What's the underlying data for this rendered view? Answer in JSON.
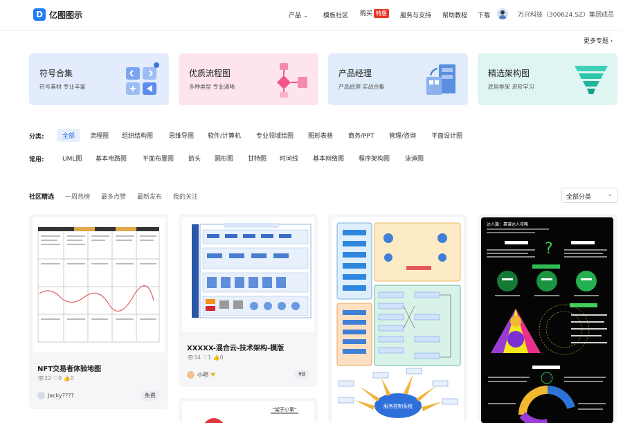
{
  "header": {
    "logo_mark": "D",
    "logo_text": "亿图图示",
    "nav": [
      {
        "label": "产品",
        "has_dropdown": true
      },
      {
        "label": "模板社区"
      },
      {
        "label": "购买",
        "badge": "特惠"
      },
      {
        "label": "服务与支持"
      },
      {
        "label": "帮助教程"
      },
      {
        "label": "下载"
      }
    ],
    "user_name": "万兴科技（300624.SZ）集团成员",
    "dropdown_glyph": "⌄"
  },
  "more_topics": "更多专题 ›",
  "topics": [
    {
      "title": "符号合集",
      "subtitle": "符号素材 专业丰富",
      "bg": "#e3ecfd",
      "accent": "#5b8def"
    },
    {
      "title": "优质流程图",
      "subtitle": "多种类型 专业清晰",
      "bg": "#fde4ee",
      "accent": "#f2568c"
    },
    {
      "title": "产品经理",
      "subtitle": "产品经理 实战合集",
      "bg": "#e1ecfb",
      "accent": "#4f86d9"
    },
    {
      "title": "精选架构图",
      "subtitle": "底层框架 进阶学习",
      "bg": "#dff5f1",
      "accent": "#2ec6ad"
    }
  ],
  "categories": {
    "label": "分类:",
    "items": [
      "全部",
      "流程图",
      "组织结构图",
      "思维导图",
      "软件/计算机",
      "专业领域绘图",
      "图形表格",
      "商务/PPT",
      "管理/咨询",
      "平面设计图"
    ],
    "active": 0
  },
  "common": {
    "label": "常用:",
    "items": [
      "UML图",
      "基本电路图",
      "平面布置图",
      "箭头",
      "圆形图",
      "甘特图",
      "时间线",
      "基本网络图",
      "程序架构图",
      "泳道图"
    ]
  },
  "community": {
    "tabs": [
      "社区精选",
      "一周热榜",
      "最多点赞",
      "最新发布",
      "我的关注"
    ],
    "active": 0,
    "sort_value": "全部分类",
    "sort_caret": "⌄"
  },
  "templates": [
    {
      "name": "NFT交易者体验地图",
      "views": "22",
      "likes": "0",
      "stars": "0",
      "author": "Jacky????",
      "price": "免费"
    },
    {
      "name": "XXXXX-混合云-技术架构-模版",
      "views": "34",
      "likes": "1",
      "stars": "0",
      "author": "小明",
      "price": "¥8"
    }
  ],
  "thumb_texts": {
    "t3_center": "服务控制系统",
    "t4_title": "达人篇：靠谱达人攻略",
    "t5_top": "\"架子小事\""
  },
  "colors": {
    "primary": "#1f7cf5",
    "hot": "#e8372c"
  }
}
